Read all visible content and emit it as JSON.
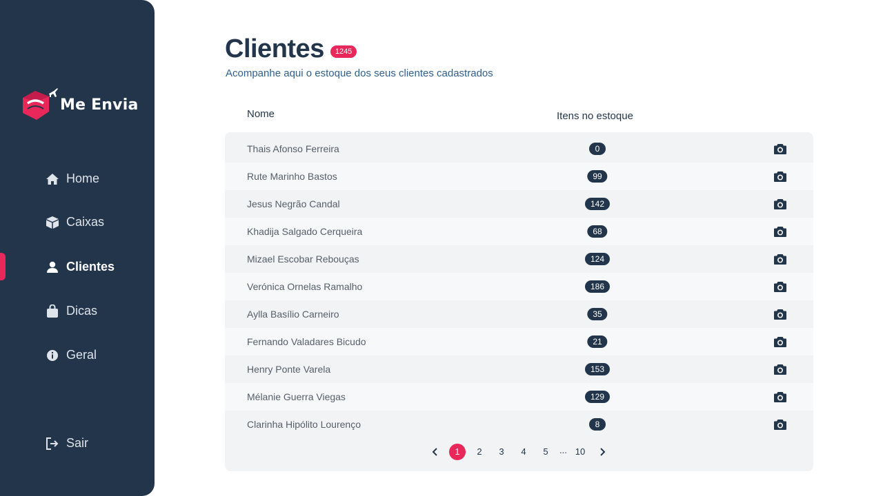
{
  "sidebar": {
    "brand": "Me Envia",
    "nav": [
      {
        "label": "Home",
        "icon": "home-icon"
      },
      {
        "label": "Caixas",
        "icon": "box-icon"
      },
      {
        "label": "Clientes",
        "icon": "user-icon"
      },
      {
        "label": "Dicas",
        "icon": "bag-icon"
      },
      {
        "label": "Geral",
        "icon": "info-icon"
      }
    ],
    "logout": {
      "label": "Sair",
      "icon": "logout-icon"
    }
  },
  "header": {
    "title": "Clientes",
    "count": "1245",
    "subtitle": "Acompanhe aqui o estoque dos seus clientes cadastrados"
  },
  "table": {
    "columns": [
      "Nome",
      "Itens no estoque"
    ],
    "rows": [
      {
        "name": "Thais Afonso Ferreira",
        "items": "0"
      },
      {
        "name": "Rute Marinho Bastos",
        "items": "99"
      },
      {
        "name": "Jesus Negrão Candal",
        "items": "142"
      },
      {
        "name": "Khadija Salgado Cerqueira",
        "items": "68"
      },
      {
        "name": "Mizael Escobar Rebouças",
        "items": "124"
      },
      {
        "name": "Verónica Ornelas Ramalho",
        "items": "186"
      },
      {
        "name": "Aylla Basílio Carneiro",
        "items": "35"
      },
      {
        "name": "Fernando Valadares Bicudo",
        "items": "21"
      },
      {
        "name": "Henry Ponte Varela",
        "items": "153"
      },
      {
        "name": "Mélanie Guerra Viegas",
        "items": "129"
      },
      {
        "name": "Clarinha Hipólito Lourenço",
        "items": "8"
      }
    ]
  },
  "pagination": {
    "pages": [
      "1",
      "2",
      "3",
      "4",
      "5"
    ],
    "ellipsis": "...",
    "last": "10",
    "current": "1"
  },
  "colors": {
    "sidebar": "#22354b",
    "accent": "#e8275b",
    "table_bg": "#f2f3f5"
  }
}
